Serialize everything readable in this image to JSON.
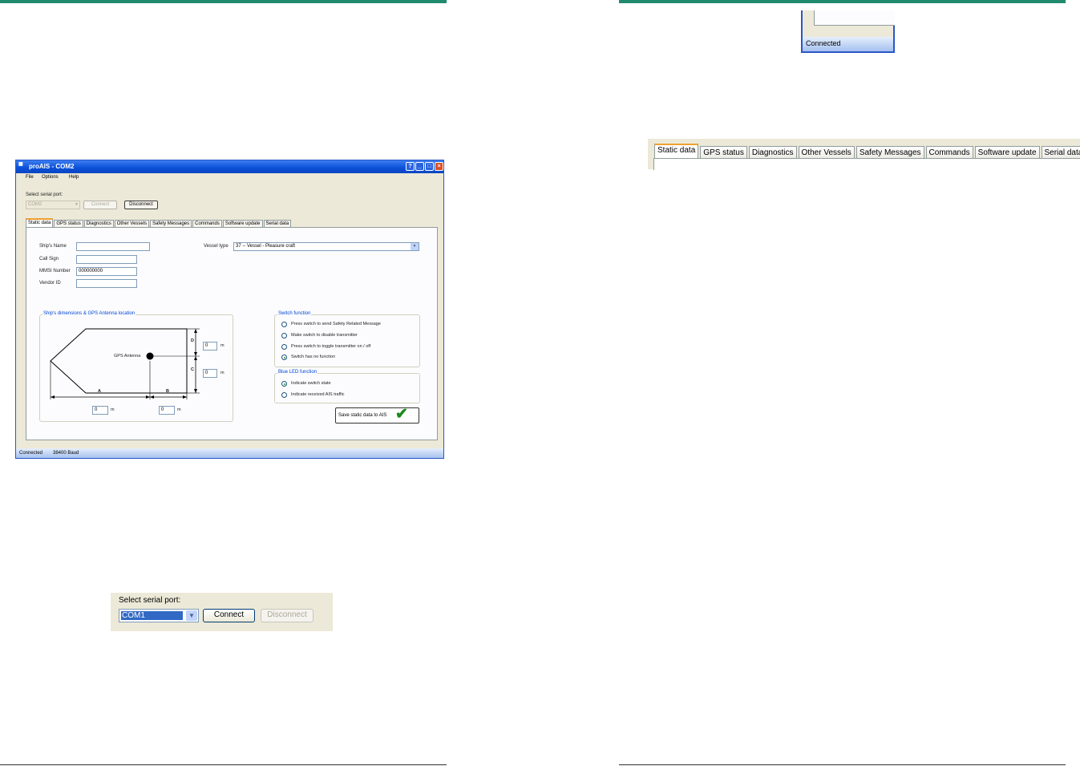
{
  "window": {
    "title": "proAIS - COM2",
    "menu": [
      "File",
      "Options",
      "Help"
    ],
    "serial": {
      "label": "Select serial port:",
      "port": "COM2",
      "connect_label": "Connect",
      "disconnect_label": "Disconnect"
    },
    "tabs": [
      "Static data",
      "GPS status",
      "Diagnostics",
      "Other Vessels",
      "Safety Messages",
      "Commands",
      "Software update",
      "Serial data"
    ],
    "active_tab": "Static data",
    "static": {
      "ship_name_label": "Ship's Name",
      "ship_name_value": "",
      "call_sign_label": "Call Sign",
      "call_sign_value": "",
      "mmsi_label": "MMSI Number",
      "mmsi_value": "000000000",
      "vendor_label": "Vendor ID",
      "vendor_value": "",
      "vessel_type_label": "Vessel type",
      "vessel_type_value": "37 -- Vessel - Pleasure craft"
    },
    "dimensions": {
      "group_label": "Ship's dimensions & GPS Antenna location",
      "antenna_label": "GPS Antenna",
      "label_a": "A",
      "label_b": "B",
      "label_c": "C",
      "label_d": "D",
      "value_a": "0",
      "value_b": "0",
      "value_c": "0",
      "value_d": "0",
      "unit": "m"
    },
    "switch_function": {
      "group_label": "Switch function",
      "options": [
        "Press switch to send Safety Related Message",
        "Make switch to disable transmitter",
        "Press switch to toggle transmitter on / off",
        "Switch has no function"
      ],
      "selected_index": 3
    },
    "blue_led": {
      "group_label": "Blue LED function",
      "options": [
        "Indicate switch state",
        "Indicate received AIS traffic"
      ],
      "selected_index": 0
    },
    "save_label": "Save static data to AIS",
    "status": {
      "connection": "Connected",
      "baud": "38400 Baud"
    }
  },
  "zoom_serial": {
    "label": "Select serial port:",
    "port": "COM1",
    "connect_label": "Connect",
    "disconnect_label": "Disconnect"
  },
  "zoom_status": {
    "connection": "Connected"
  },
  "zoom_tabs": {
    "tabs": [
      "Static data",
      "GPS status",
      "Diagnostics",
      "Other Vessels",
      "Safety Messages",
      "Commands",
      "Software update",
      "Serial data"
    ]
  },
  "colors": {
    "accent_rule": "#1f8a6e",
    "titlebar": "#0a4fd8",
    "group_label": "#0046d5",
    "check": "#1a8a1a"
  }
}
